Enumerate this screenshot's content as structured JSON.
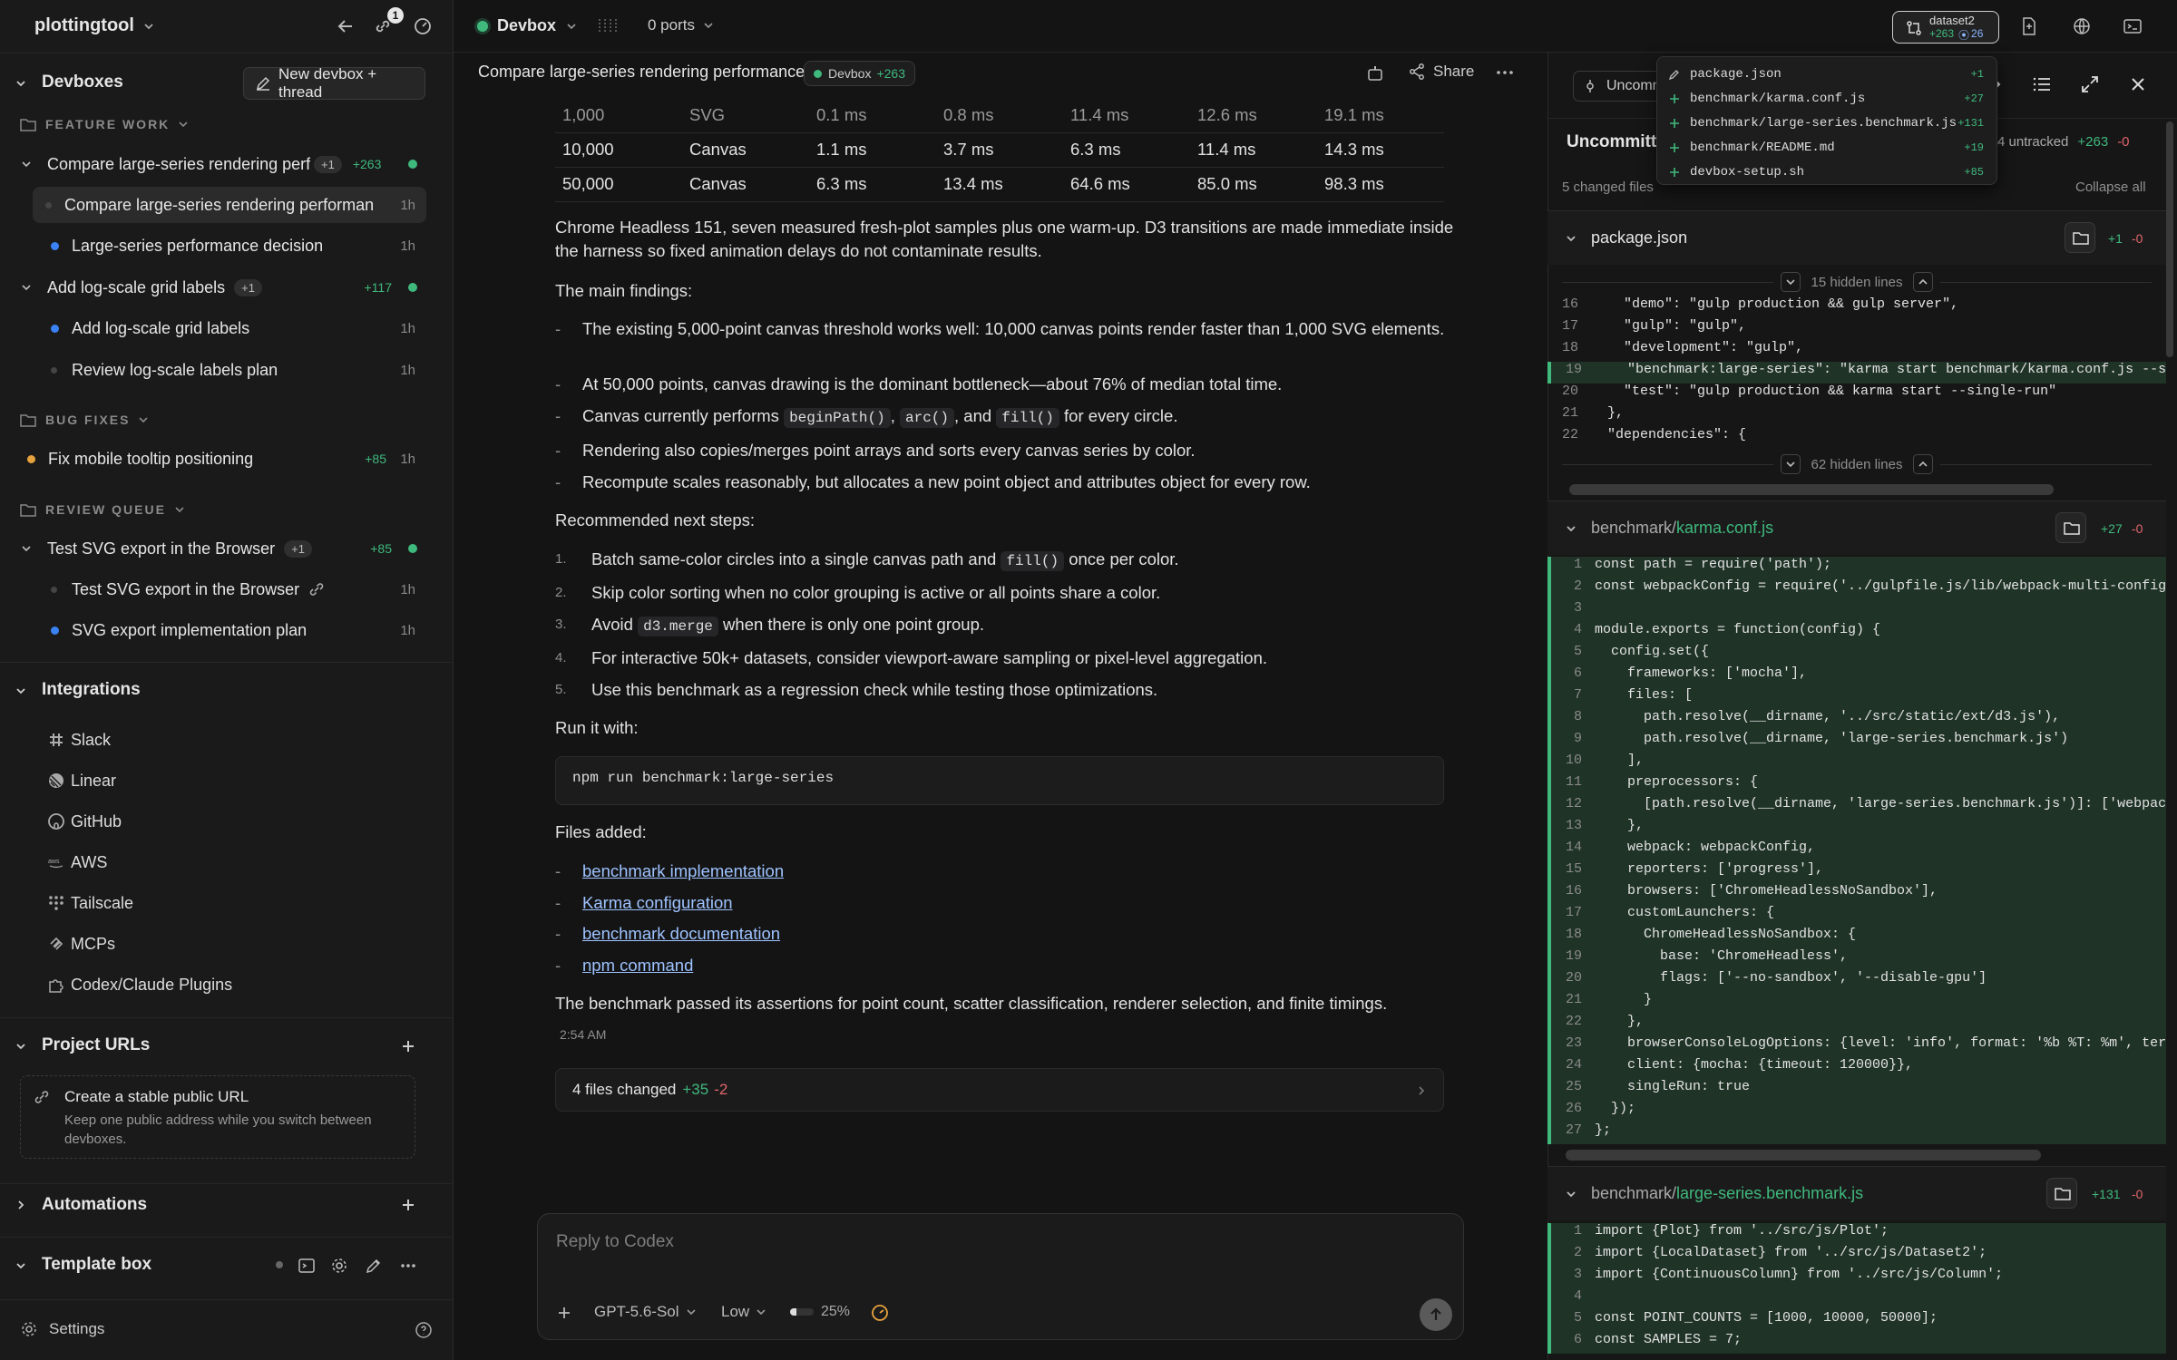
{
  "sidebar": {
    "app_name": "plottingtool",
    "notif_count": "1",
    "devboxes_title": "Devboxes",
    "new_button": "New devbox + thread",
    "groups": [
      {
        "label": "FEATURE WORK"
      },
      {
        "label": "BUG FIXES"
      },
      {
        "label": "REVIEW QUEUE"
      }
    ],
    "threads": [
      {
        "label": "Compare large-series rendering perfo",
        "badge": "+1",
        "diff": "+263"
      },
      {
        "label": "Compare large-series rendering performance",
        "time": "1h"
      },
      {
        "label": "Large-series performance decision",
        "time": "1h"
      },
      {
        "label": "Add log-scale grid labels",
        "badge": "+1",
        "diff": "+117"
      },
      {
        "label": "Add log-scale grid labels",
        "time": "1h"
      },
      {
        "label": "Review log-scale labels plan",
        "time": "1h"
      },
      {
        "label": "Fix mobile tooltip positioning",
        "diff": "+85",
        "time": "1h"
      },
      {
        "label": "Test SVG export in the Browser",
        "badge": "+1",
        "diff": "+85"
      },
      {
        "label": "Test SVG export in the Browser",
        "time": "1h"
      },
      {
        "label": "SVG export implementation plan",
        "time": "1h"
      }
    ],
    "integrations_title": "Integrations",
    "integrations": [
      "Slack",
      "Linear",
      "GitHub",
      "AWS",
      "Tailscale",
      "MCPs",
      "Codex/Claude Plugins"
    ],
    "project_urls_title": "Project URLs",
    "url_card_title": "Create a stable public URL",
    "url_card_desc": "Keep one public address while you switch between devboxes.",
    "automations_title": "Automations",
    "template_title": "Template box",
    "settings": "Settings"
  },
  "topbar": {
    "devbox": "Devbox",
    "ports": "0 ports",
    "dataset_name": "dataset2",
    "dataset_add": "+263",
    "dataset_count": "26"
  },
  "chat": {
    "title": "Compare large-series rendering performance",
    "chip": "Devbox",
    "chip_diff": "+263",
    "share": "Share",
    "table": [
      [
        "1,000",
        "SVG",
        "0.1 ms",
        "0.8 ms",
        "11.4 ms",
        "12.6 ms",
        "19.1 ms"
      ],
      [
        "10,000",
        "Canvas",
        "1.1 ms",
        "3.7 ms",
        "6.3 ms",
        "11.4 ms",
        "14.3 ms"
      ],
      [
        "50,000",
        "Canvas",
        "6.3 ms",
        "13.4 ms",
        "64.6 ms",
        "85.0 ms",
        "98.3 ms"
      ]
    ],
    "intro": "Chrome Headless 151, seven measured fresh-plot samples plus one warm-up. D3 transitions are made immediate inside the harness so fixed animation delays do not contaminate results.",
    "findings_title": "The main findings:",
    "f1": "The existing 5,000-point canvas threshold works well: 10,000 canvas points render faster than 1,000 SVG elements.",
    "f2": "At 50,000 points, canvas drawing is the dominant bottleneck—about 76% of median total time.",
    "f3_pre": "Canvas currently performs",
    "f3_c1": "beginPath()",
    "f3_sep": ",",
    "f3_c2": "arc()",
    "f3_and": ", and",
    "f3_c3": "fill()",
    "f3_post": "for every circle.",
    "f4": "Rendering also copies/merges point arrays and sorts every canvas series by color.",
    "f5": "Recompute scales reasonably, but allocates a new point object and attributes object for every row.",
    "next_title": "Recommended next steps:",
    "s1_pre": "Batch same-color circles into a single canvas path and",
    "s1_code": "fill()",
    "s1_post": "once per color.",
    "s2": "Skip color sorting when no color grouping is active or all points share a color.",
    "s3_pre": "Avoid",
    "s3_code": "d3.merge",
    "s3_post": "when there is only one point group.",
    "s4": "For interactive 50k+ datasets, consider viewport-aware sampling or pixel-level aggregation.",
    "s5": "Use this benchmark as a regression check while testing those optimizations.",
    "run_title": "Run it with:",
    "run_cmd": "npm run benchmark:large-series",
    "files_title": "Files added:",
    "links": [
      "benchmark implementation",
      "Karma configuration",
      "benchmark documentation",
      "npm command"
    ],
    "conclusion": "The benchmark passed its assertions for point count, scatter classification, renderer selection, and finite timings.",
    "timestamp": "2:54 AM",
    "files_changed": "4 files changed",
    "fc_add": "+35",
    "fc_del": "-2",
    "reply_placeholder": "Reply to Codex",
    "model": "GPT-5.6-Sol",
    "effort": "Low",
    "context": "25%"
  },
  "diff": {
    "uncommitted_btn": "Uncomm",
    "uncommitted_title": "Uncommitte",
    "untracked": "4 untracked",
    "total_add": "+263",
    "total_del": "-0",
    "changed": "5 changed files",
    "collapse": "Collapse all",
    "popup": [
      {
        "name": "package.json",
        "n": "+1"
      },
      {
        "name": "benchmark/karma.conf.js",
        "n": "+27"
      },
      {
        "name": "benchmark/large-series.benchmark.js",
        "n": "+131"
      },
      {
        "name": "benchmark/README.md",
        "n": "+19"
      },
      {
        "name": "devbox-setup.sh",
        "n": "+85"
      }
    ],
    "file1": "package.json",
    "file1_add": "+1",
    "file1_del": "-0",
    "hidden1": "15 hidden lines",
    "hidden2": "62 hidden lines",
    "pkg_lines": [
      {
        "n": "16",
        "t": "    \"demo\": \"gulp production && gulp server\","
      },
      {
        "n": "17",
        "t": "    \"gulp\": \"gulp\","
      },
      {
        "n": "18",
        "t": "    \"development\": \"gulp\","
      },
      {
        "n": "19",
        "t": "    \"benchmark:large-series\": \"karma start benchmark/karma.conf.js --sir"
      },
      {
        "n": "20",
        "t": "    \"test\": \"gulp production && karma start --single-run\""
      },
      {
        "n": "21",
        "t": "  },"
      },
      {
        "n": "22",
        "t": "  \"dependencies\": {"
      }
    ],
    "file2_dir": "benchmark/",
    "file2_name": "karma.conf.js",
    "file2_add": "+27",
    "file2_del": "-0",
    "karma_lines": [
      {
        "n": "1",
        "t": "const path = require('path');"
      },
      {
        "n": "2",
        "t": "const webpackConfig = require('../gulpfile.js/lib/webpack-multi-config')"
      },
      {
        "n": "3",
        "t": ""
      },
      {
        "n": "4",
        "t": "module.exports = function(config) {"
      },
      {
        "n": "5",
        "t": "  config.set({"
      },
      {
        "n": "6",
        "t": "    frameworks: ['mocha'],"
      },
      {
        "n": "7",
        "t": "    files: ["
      },
      {
        "n": "8",
        "t": "      path.resolve(__dirname, '../src/static/ext/d3.js'),"
      },
      {
        "n": "9",
        "t": "      path.resolve(__dirname, 'large-series.benchmark.js')"
      },
      {
        "n": "10",
        "t": "    ],"
      },
      {
        "n": "11",
        "t": "    preprocessors: {"
      },
      {
        "n": "12",
        "t": "      [path.resolve(__dirname, 'large-series.benchmark.js')]: ['webpack'"
      },
      {
        "n": "13",
        "t": "    },"
      },
      {
        "n": "14",
        "t": "    webpack: webpackConfig,"
      },
      {
        "n": "15",
        "t": "    reporters: ['progress'],"
      },
      {
        "n": "16",
        "t": "    browsers: ['ChromeHeadlessNoSandbox'],"
      },
      {
        "n": "17",
        "t": "    customLaunchers: {"
      },
      {
        "n": "18",
        "t": "      ChromeHeadlessNoSandbox: {"
      },
      {
        "n": "19",
        "t": "        base: 'ChromeHeadless',"
      },
      {
        "n": "20",
        "t": "        flags: ['--no-sandbox', '--disable-gpu']"
      },
      {
        "n": "21",
        "t": "      }"
      },
      {
        "n": "22",
        "t": "    },"
      },
      {
        "n": "23",
        "t": "    browserConsoleLogOptions: {level: 'info', format: '%b %T: %m', term"
      },
      {
        "n": "24",
        "t": "    client: {mocha: {timeout: 120000}},"
      },
      {
        "n": "25",
        "t": "    singleRun: true"
      },
      {
        "n": "26",
        "t": "  });"
      },
      {
        "n": "27",
        "t": "};"
      }
    ],
    "file3_dir": "benchmark/",
    "file3_name": "large-series.benchmark.js",
    "file3_add": "+131",
    "file3_del": "-0",
    "bench_lines": [
      {
        "n": "1",
        "t": "import {Plot} from '../src/js/Plot';"
      },
      {
        "n": "2",
        "t": "import {LocalDataset} from '../src/js/Dataset2';"
      },
      {
        "n": "3",
        "t": "import {ContinuousColumn} from '../src/js/Column';"
      },
      {
        "n": "4",
        "t": ""
      },
      {
        "n": "5",
        "t": "const POINT_COUNTS = [1000, 10000, 50000];"
      },
      {
        "n": "6",
        "t": "const SAMPLES = 7;"
      }
    ]
  },
  "colors": {
    "accent_green": "#3fb97c",
    "accent_blue": "#3b82f6",
    "accent_orange": "#e6a23c",
    "delete_red": "#e0656b"
  }
}
